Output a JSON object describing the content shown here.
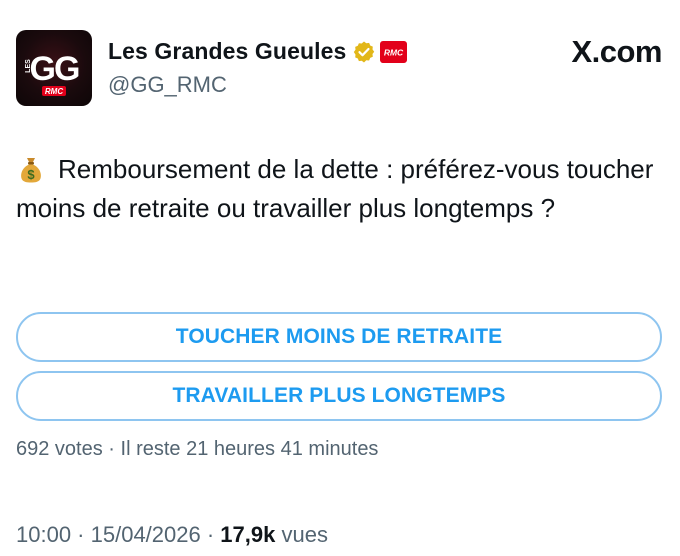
{
  "account": {
    "display_name": "Les Grandes Gueules",
    "handle": "@GG_RMC",
    "avatar_text": "GG",
    "avatar_small_text": "LES",
    "avatar_tag": "RMC",
    "badge_text": "RMC"
  },
  "site": {
    "logo_text": "X.com"
  },
  "tweet": {
    "emoji_icon": "money-bag-icon",
    "text": "Remboursement de la dette : préférez-vous toucher moins de retraite ou travailler plus longtemps ?"
  },
  "poll": {
    "options": [
      {
        "label": "TOUCHER MOINS DE RETRAITE"
      },
      {
        "label": "TRAVAILLER PLUS LONGTEMPS"
      }
    ],
    "votes": "692 votes",
    "separator": " · ",
    "remaining": "Il reste 21 heures 41 minutes"
  },
  "meta": {
    "time": "10:00",
    "separator": " · ",
    "date": "15/04/2026",
    "separator2": " · ",
    "views_count": "17,9k",
    "views_label": " vues"
  },
  "colors": {
    "accent": "#1d9bf0",
    "border": "#8ec5f0",
    "muted": "#536471",
    "text": "#0f1419",
    "brand_red": "#e2001a",
    "verified_gold": "#e2b719"
  }
}
